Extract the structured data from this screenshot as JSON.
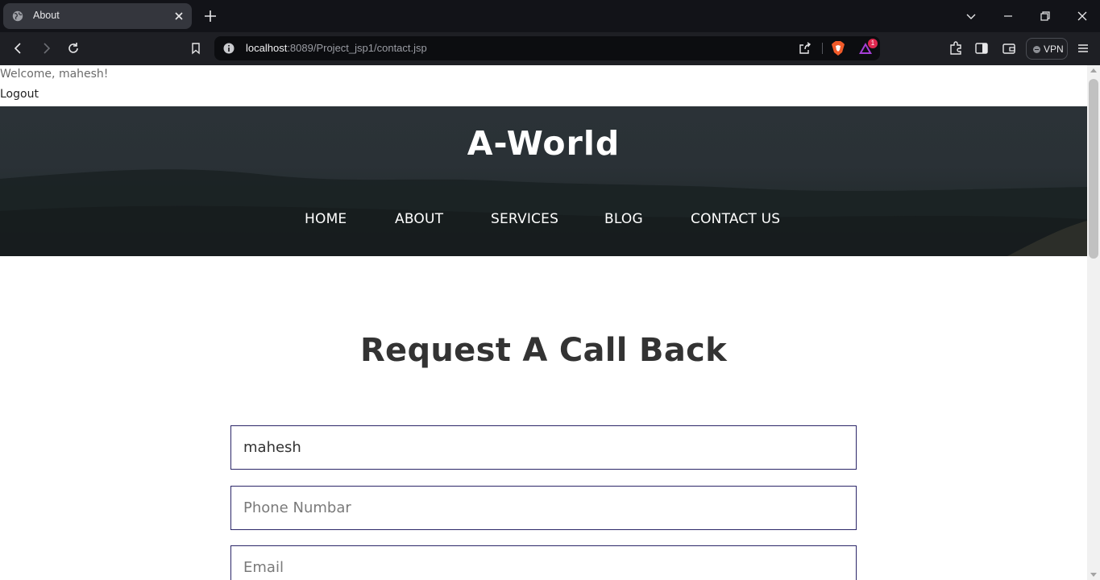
{
  "browser": {
    "tab_title": "About",
    "url_host": "localhost",
    "url_rest": ":8089/Project_jsp1/contact.jsp",
    "rewards_badge": "1",
    "vpn_label": "VPN"
  },
  "page": {
    "welcome_text": "Welcome, mahesh!",
    "logout_label": "Logout",
    "brand": "A-World",
    "nav": [
      "HOME",
      "ABOUT",
      "SERVICES",
      "BLOG",
      "CONTACT US"
    ],
    "heading": "Request A Call Back",
    "form": {
      "name_value": "mahesh",
      "phone_placeholder": "Phone Numbar",
      "email_placeholder": "Email"
    }
  },
  "colors": {
    "field_border": "#2b2668",
    "heading": "#333333"
  }
}
